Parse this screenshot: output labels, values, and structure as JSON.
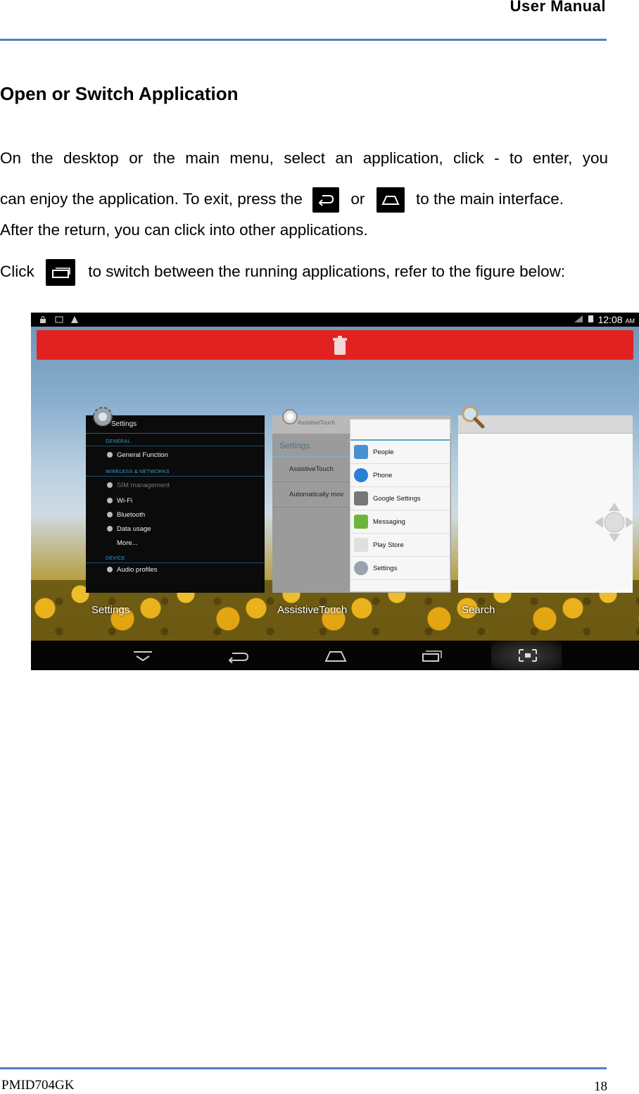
{
  "header": {
    "title": "User  Manual"
  },
  "section": {
    "heading": "Open or Switch Application"
  },
  "body": {
    "p1": "On the desktop or the main menu, select an application, click - to enter, you",
    "p2_a": "can enjoy the application. To exit, press the",
    "p2_or": "or",
    "p2_b": "to the main interface.",
    "p3": "After the return, you can click into other applications.",
    "p4_a": "Click",
    "p4_b": "to switch between the running applications, refer to the figure below:"
  },
  "icons": {
    "back": "back-arrow-icon",
    "home": "home-icon",
    "recent": "recent-apps-icon"
  },
  "screenshot": {
    "clock": "12:08",
    "ampm": "AM",
    "settings_card": {
      "title": "Settings",
      "sections": [
        {
          "heading": "GENERAL",
          "rows": [
            "General Function"
          ]
        },
        {
          "heading": "WIRELESS & NETWORKS",
          "rows": [
            "SIM management",
            "Wi-Fi",
            "Bluetooth",
            "Data usage",
            "More..."
          ]
        },
        {
          "heading": "DEVICE",
          "rows": [
            "Audio profiles"
          ]
        }
      ],
      "label": "Settings"
    },
    "assist_card": {
      "head": "AssistiveTouch",
      "title": "Settings",
      "rows": [
        "AssistiveTouch",
        "Automatically mov"
      ],
      "label": "AssistiveTouch"
    },
    "menu_items": [
      "People",
      "Phone",
      "Google Settings",
      "Messaging",
      "Play Store",
      "Settings"
    ],
    "search_card": {
      "label": "Search"
    }
  },
  "footer": {
    "model": "PMID704GK",
    "page": "18"
  },
  "colors": {
    "rule": "#4f81bd",
    "trash_bar": "#e22121",
    "accent": "#35a0d8"
  }
}
